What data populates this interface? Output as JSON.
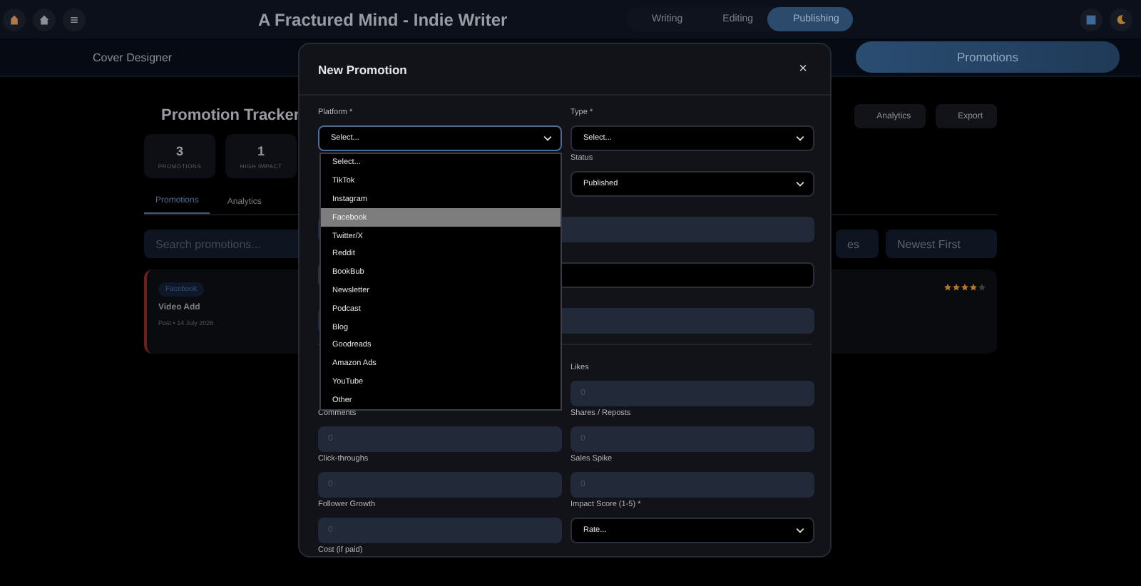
{
  "header": {
    "title": "A Fractured Mind - Indie Writer",
    "modes": [
      {
        "label": "Writing",
        "selected": false
      },
      {
        "label": "Editing",
        "selected": false
      },
      {
        "label": "Publishing",
        "selected": true
      }
    ]
  },
  "subnav": [
    {
      "label": "Cover Designer",
      "selected": false
    },
    {
      "label": "Promotions",
      "selected": true
    }
  ],
  "page": {
    "title": "Promotion Tracker",
    "stats": [
      {
        "value": "3",
        "label": "PROMOTIONS"
      },
      {
        "value": "1",
        "label": "HIGH IMPACT"
      }
    ],
    "actions": [
      "Analytics",
      "Export"
    ],
    "tabs": [
      {
        "label": "Promotions",
        "selected": true
      },
      {
        "label": "Analytics",
        "selected": false
      }
    ],
    "search": {
      "placeholder": "Search promotions..."
    },
    "filter": {
      "value": "es"
    },
    "sort": {
      "value": "Newest First"
    },
    "promotions": [
      {
        "platform": "Facebook",
        "title": "Video Add",
        "meta": "Post • 14 July 2026",
        "stars": 4
      }
    ]
  },
  "modal": {
    "title": "New Promotion",
    "close": "×",
    "sections": [
      {
        "rows": [
          {
            "left": {
              "kind": "select",
              "label": "Platform *",
              "value": "Select...",
              "focused": true,
              "dropdown": [
                {
                  "label": "Select...",
                  "highlighted": false
                },
                {
                  "label": "TikTok",
                  "highlighted": false
                },
                {
                  "label": "Instagram",
                  "highlighted": false
                },
                {
                  "label": "Facebook",
                  "highlighted": true
                },
                {
                  "label": "Twitter/X",
                  "highlighted": false
                },
                {
                  "label": "Reddit",
                  "highlighted": false
                },
                {
                  "label": "BookBub",
                  "highlighted": false
                },
                {
                  "label": "Newsletter",
                  "highlighted": false
                },
                {
                  "label": "Podcast",
                  "highlighted": false
                },
                {
                  "label": "Blog",
                  "highlighted": false
                },
                {
                  "label": "Goodreads",
                  "highlighted": false
                },
                {
                  "label": "Amazon Ads",
                  "highlighted": false
                },
                {
                  "label": "YouTube",
                  "highlighted": false
                },
                {
                  "label": "Other",
                  "highlighted": false
                }
              ]
            },
            "right": {
              "kind": "select",
              "label": "Type *",
              "value": "Select...",
              "focused": false
            }
          },
          {
            "right": {
              "kind": "select",
              "label": "Status",
              "value": "Published",
              "focused": false
            }
          },
          {
            "full": {
              "kind": "input"
            }
          },
          {
            "full": {
              "kind": "dark-input"
            }
          },
          {
            "full": {
              "kind": "input"
            }
          }
        ]
      },
      {
        "rows": [
          {
            "right": {
              "kind": "input",
              "label": "Likes",
              "placeholder": "0"
            }
          },
          {
            "left": {
              "kind": "input",
              "label": "Comments",
              "placeholder": "0"
            },
            "right": {
              "kind": "input",
              "label": "Shares / Reposts",
              "placeholder": "0"
            }
          },
          {
            "left": {
              "kind": "input",
              "label": "Click-throughs",
              "placeholder": "0"
            },
            "right": {
              "kind": "input",
              "label": "Sales Spike",
              "placeholder": "0"
            }
          },
          {
            "left": {
              "kind": "input",
              "label": "Follower Growth",
              "placeholder": "0"
            },
            "right": {
              "kind": "select",
              "label": "Impact Score (1-5) *",
              "value": "Rate...",
              "focused": false
            }
          },
          {
            "left": {
              "kind": "label-only",
              "label": "Cost (if paid)"
            }
          }
        ]
      }
    ]
  }
}
